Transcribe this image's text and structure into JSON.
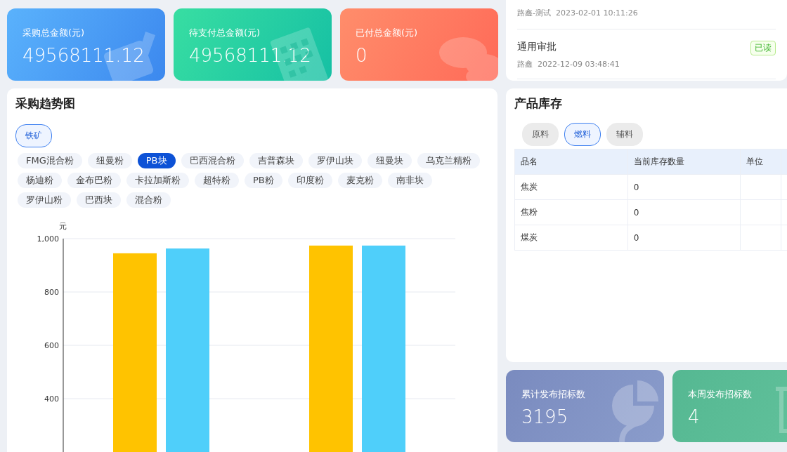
{
  "stat_cards": [
    {
      "kind": "purchase",
      "label": "采购总金额(元)",
      "value": "49568111.12"
    },
    {
      "kind": "pending",
      "label": "待支付总金额(元)",
      "value": "49568111.12"
    },
    {
      "kind": "paid",
      "label": "已付总金额(元)",
      "value": "0"
    }
  ],
  "notices": [
    {
      "sender": "路鑫-测试",
      "time": "2023-02-01 10:11:26"
    },
    {
      "title": "通用审批",
      "status": "已读",
      "sender": "路鑫",
      "time": "2022-12-09 03:48:41"
    }
  ],
  "trend": {
    "title": "采购趋势图",
    "categories": [
      {
        "label": "铁矿",
        "selected": true
      }
    ],
    "materials": [
      {
        "label": "FMG混合粉",
        "selected": false
      },
      {
        "label": "纽曼粉",
        "selected": false
      },
      {
        "label": "PB块",
        "selected": true
      },
      {
        "label": "巴西混合粉",
        "selected": false
      },
      {
        "label": "吉普森块",
        "selected": false
      },
      {
        "label": "罗伊山块",
        "selected": false
      },
      {
        "label": "纽曼块",
        "selected": false
      },
      {
        "label": "乌克兰精粉",
        "selected": false
      },
      {
        "label": "杨迪粉",
        "selected": false
      },
      {
        "label": "金布巴粉",
        "selected": false
      },
      {
        "label": "卡拉加斯粉",
        "selected": false
      },
      {
        "label": "超特粉",
        "selected": false
      },
      {
        "label": "PB粉",
        "selected": false
      },
      {
        "label": "印度粉",
        "selected": false
      },
      {
        "label": "麦克粉",
        "selected": false
      },
      {
        "label": "南非块",
        "selected": false
      },
      {
        "label": "罗伊山粉",
        "selected": false
      },
      {
        "label": "巴西块",
        "selected": false
      },
      {
        "label": "混合粉",
        "selected": false
      }
    ],
    "chart_data": {
      "type": "bar",
      "grid": true,
      "ylabel": "元",
      "ylim": [
        0,
        1000
      ],
      "yticks": [
        400,
        600,
        800,
        {
          "value": 1000,
          "label": "1,000"
        }
      ],
      "series": [
        {
          "color": "#ffc300",
          "values": [
            945,
            974
          ]
        },
        {
          "color": "#4fcffa",
          "values": [
            963,
            974
          ]
        }
      ]
    }
  },
  "stock": {
    "title": "产品库存",
    "tabs": [
      {
        "label": "原料",
        "selected": false
      },
      {
        "label": "燃料",
        "selected": true
      },
      {
        "label": "辅料",
        "selected": false
      }
    ],
    "columns": [
      "品名",
      "当前库存数量",
      "单位"
    ],
    "rows": [
      {
        "name": "焦炭",
        "quantity": "0"
      },
      {
        "name": "焦粉",
        "quantity": "0"
      },
      {
        "name": "煤炭",
        "quantity": "0"
      }
    ]
  },
  "tender_cards": [
    {
      "kind": "total",
      "label": "累计发布招标数",
      "value": "3195"
    },
    {
      "kind": "week",
      "label": "本周发布招标数",
      "value": "4"
    }
  ]
}
